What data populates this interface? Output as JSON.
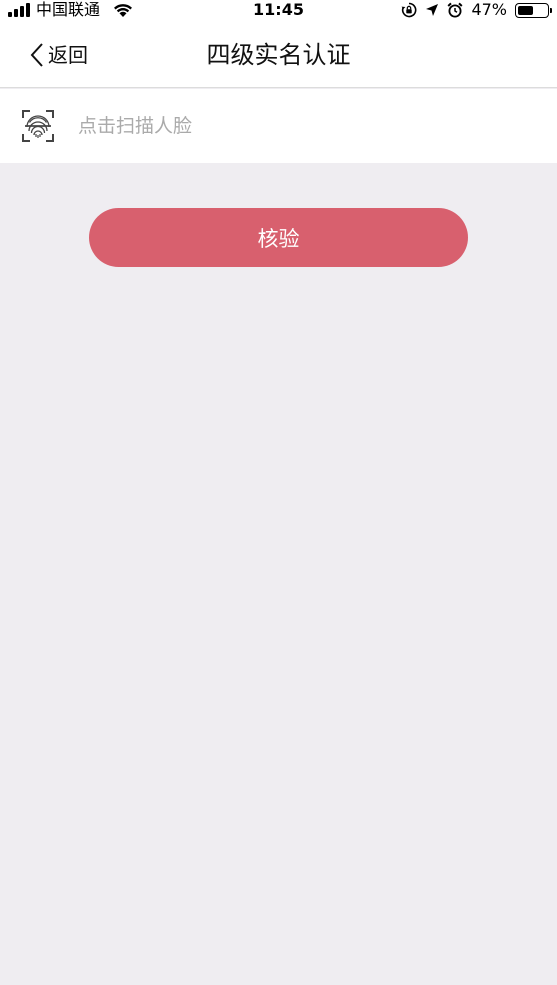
{
  "status_bar": {
    "carrier": "中国联通",
    "time": "11:45",
    "battery_percent_label": "47%",
    "battery_level": 0.47,
    "icons": [
      "signal-bars-icon",
      "wifi-icon",
      "orientation-lock-icon",
      "location-arrow-icon",
      "alarm-icon",
      "battery-icon"
    ]
  },
  "nav": {
    "back_label": "返回",
    "title": "四级实名认证",
    "back_icon": "chevron-left-icon"
  },
  "scan": {
    "label": "点击扫描人脸",
    "icon": "face-scan-icon"
  },
  "verify_button": {
    "label": "核验",
    "color": "#d8606e"
  },
  "colors": {
    "background": "#efedf1",
    "surface": "#ffffff",
    "placeholder_text": "#aaaaaa"
  }
}
